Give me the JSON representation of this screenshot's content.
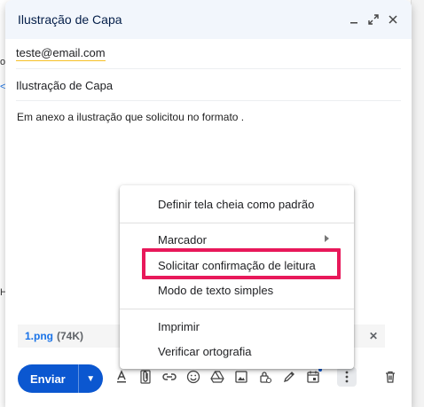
{
  "compose": {
    "title": "Ilustração de Capa",
    "to": "teste@email.com",
    "subject": "Ilustração de Capa",
    "body": "Em anexo a ilustração que solicitou no formato .",
    "attachment": {
      "name": "1.png",
      "size": "(74K)"
    },
    "send_label": "Enviar"
  },
  "titlebar_icons": [
    "minimize-icon",
    "expand-icon",
    "close-icon"
  ],
  "menu": {
    "items": [
      {
        "label": "Definir tela cheia como padrão"
      },
      {
        "label": "Marcador"
      },
      {
        "label": "Solicitar confirmação de leitura"
      },
      {
        "label": "Modo de texto simples"
      },
      {
        "label": "Imprimir"
      },
      {
        "label": "Verificar ortografia"
      }
    ]
  },
  "background_fragments": [
    "o",
    "<",
    "H"
  ],
  "colors": {
    "titlebar_bg": "#f2f6fc",
    "send_button": "#0b57d0",
    "highlight_border": "#e8185a",
    "attachment_link": "#1a73e8"
  }
}
